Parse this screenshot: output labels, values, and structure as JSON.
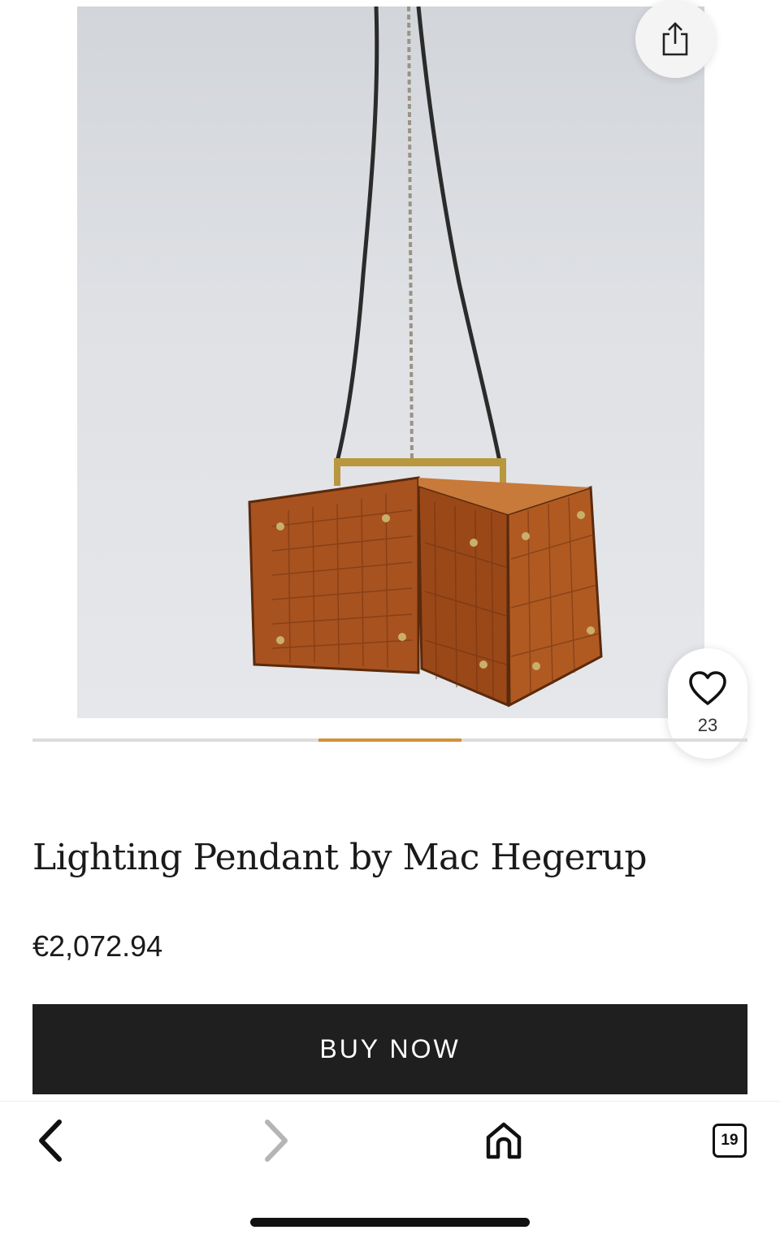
{
  "product": {
    "title": "Lighting Pendant by Mac Hegerup",
    "price": "€2,072.94",
    "favorites_count": "23",
    "image_icon": "product-photo"
  },
  "actions": {
    "buy_label": "BUY NOW",
    "share_icon": "share-icon",
    "favorite_icon": "heart-icon"
  },
  "carousel": {
    "active_index": 3,
    "total": 5,
    "accent_color": "#d4903a"
  },
  "browser_toolbar": {
    "back_icon": "chevron-left-icon",
    "forward_icon": "chevron-right-icon",
    "home_icon": "home-icon",
    "tabs_count": "19"
  },
  "colors": {
    "button_bg": "#1f1f1f",
    "button_text": "#ffffff",
    "lamp_amber": "#a8521f"
  }
}
